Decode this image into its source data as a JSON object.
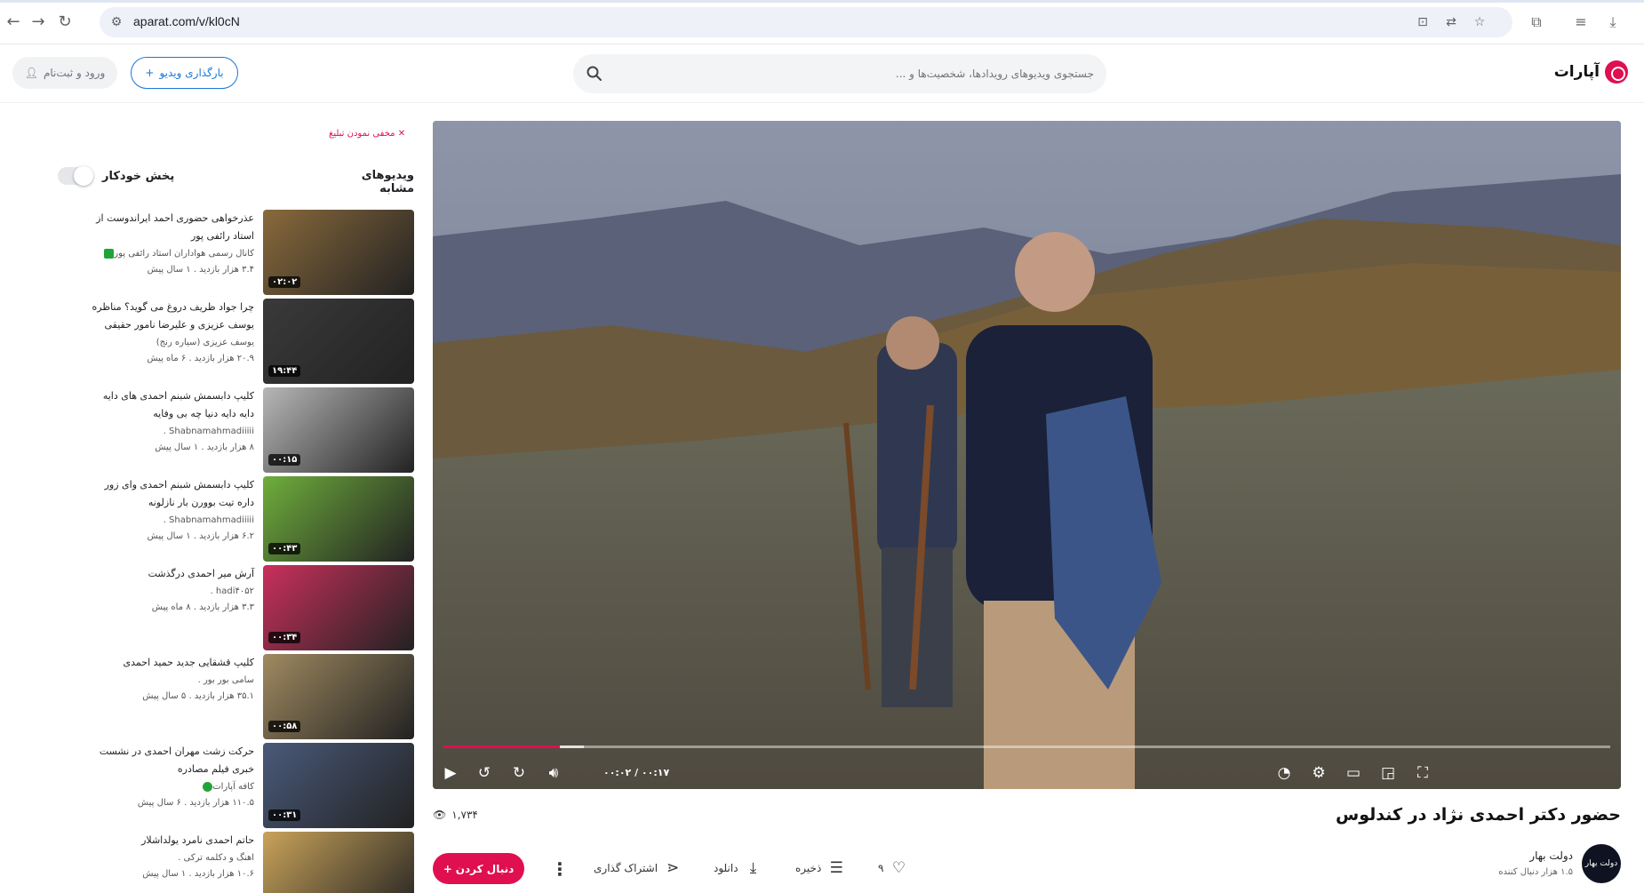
{
  "browser": {
    "url": "aparat.com/v/kl0cN"
  },
  "header": {
    "logo_text": "آپارات",
    "search_placeholder": "جستجوی ویدیوهای رویدادها، شخصیت‌ها و ...",
    "upload_label": "بارگذاری ویدیو",
    "login_label": "ورود و ثبت‌نام"
  },
  "sidebar": {
    "hide_ad_label": "مخفی نمودن تبلیغ",
    "title": "ویدیوهای مشابه",
    "autoplay_label": "پخش خودکار",
    "autoplay_on": false,
    "items": [
      {
        "title": "عذرخواهی حضوری احمد ایراندوست از استاد رائفی پور",
        "channel": "کانال رسمی هواداران استاد رائفی پور",
        "meta": "۳.۴ هزار بازدید  .  ۱ سال پیش",
        "duration": "۰۲:۰۲",
        "verified": "square",
        "thumb_color": "#8a6a3c"
      },
      {
        "title": "چرا جواد ظریف دروغ می گوید؟ مناظره یوسف عزیزی و علیرضا نامور حقیقی",
        "channel": "یوسف عزیزی (سیاره رنج)",
        "meta": "۲۰.۹ هزار بازدید  .  ۶ ماه پیش",
        "duration": "۱۹:۴۴",
        "verified": "",
        "thumb_color": "#3a3a3a"
      },
      {
        "title": "کلیپ دابسمش شبنم احمدی های دایه دایه دایه دنیا چه بی وفایه",
        "channel": "Shabnamahmadiiiii  .",
        "meta": "۸ هزار بازدید  .  ۱ سال پیش",
        "duration": "۰۰:۱۵",
        "verified": "",
        "thumb_color": "#b7b7b7"
      },
      {
        "title": "کلیپ دابسمش شبنم احمدی وای زور داره تیت بوورن بار نازلونه",
        "channel": "Shabnamahmadiiiii  .",
        "meta": "۶.۲ هزار بازدید  .  ۱ سال پیش",
        "duration": "۰۰:۴۳",
        "verified": "",
        "thumb_color": "#6fae3c"
      },
      {
        "title": "آرش میر احمدی درگذشت",
        "channel": "hadi۴۰۵۲  .",
        "meta": "۳.۳ هزار بازدید  .  ۸ ماه پیش",
        "duration": "۰۰:۳۴",
        "verified": "",
        "thumb_color": "#c9305c"
      },
      {
        "title": "کلیپ قشقایی جدید حمید احمدی",
        "channel": "سامی بور بور  .",
        "meta": "۳۵.۱ هزار بازدید  .  ۵ سال پیش",
        "duration": "۰۰:۵۸",
        "verified": "",
        "thumb_color": "#a08a60"
      },
      {
        "title": "حرکت زشت مهران احمدی در نشست خبری فیلم مصادره",
        "channel": "کافه آپارات",
        "meta": "۱۱۰.۵ هزار بازدید  .  ۶ سال پیش",
        "duration": "۰۰:۳۱",
        "verified": "round",
        "thumb_color": "#4a5a7a"
      },
      {
        "title": "حاتم احمدی نامرد یولداشلار",
        "channel": "اهنگ و دکلمه ترکی  .",
        "meta": "۱۰.۶ هزار بازدید  .  ۱ سال پیش",
        "duration": "",
        "verified": "",
        "thumb_color": "#c9a35a"
      }
    ]
  },
  "player": {
    "time_display": "۰۰:۰۲ / ۰۰:۱۷",
    "progress_fraction": 0.1,
    "buffer_fraction": 0.12
  },
  "video": {
    "title": "حضور دکتر احمدی نژاد در کندلوس",
    "views": "۱,۷۳۴",
    "like_count": "۹",
    "save_label": "ذخیره",
    "download_label": "دانلود",
    "share_label": "اشتراک گذاری",
    "follow_label": "دنبال کردن",
    "channel_name": "دولت بهار",
    "channel_subs": "۱.۵ هزار دنبال کننده",
    "channel_avatar_text": "دولت بهار"
  },
  "colors": {
    "brand": "#df0f50",
    "accent_blue": "#1877d6"
  }
}
